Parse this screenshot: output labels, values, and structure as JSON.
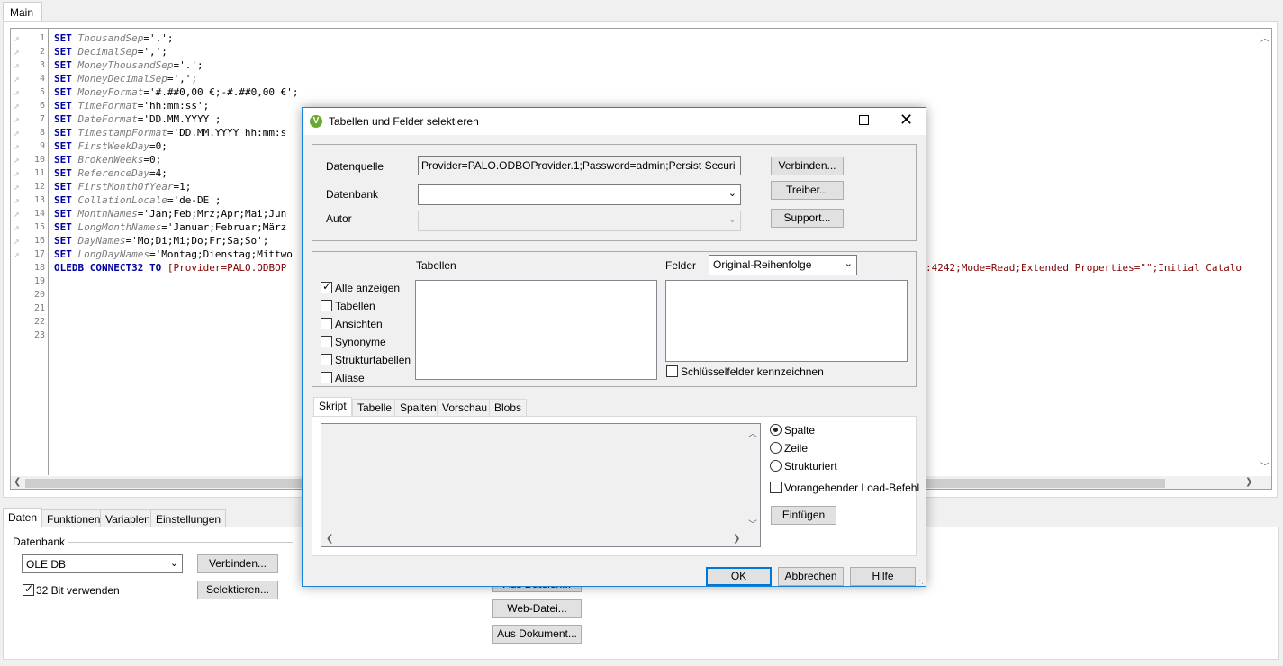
{
  "top_tab": "Main",
  "editor": {
    "lines": [
      {
        "n": "1",
        "kw": "SET",
        "var": "ThousandSep",
        "rest": "='.';"
      },
      {
        "n": "2",
        "kw": "SET",
        "var": "DecimalSep",
        "rest": "=',';"
      },
      {
        "n": "3",
        "kw": "SET",
        "var": "MoneyThousandSep",
        "rest": "='.';"
      },
      {
        "n": "4",
        "kw": "SET",
        "var": "MoneyDecimalSep",
        "rest": "=',';"
      },
      {
        "n": "5",
        "kw": "SET",
        "var": "MoneyFormat",
        "rest": "='#.##0,00 €;-#.##0,00 €';"
      },
      {
        "n": "6",
        "kw": "SET",
        "var": "TimeFormat",
        "rest": "='hh:mm:ss';"
      },
      {
        "n": "7",
        "kw": "SET",
        "var": "DateFormat",
        "rest": "='DD.MM.YYYY';"
      },
      {
        "n": "8",
        "kw": "SET",
        "var": "TimestampFormat",
        "rest": "='DD.MM.YYYY hh:mm:s"
      },
      {
        "n": "9",
        "kw": "SET",
        "var": "FirstWeekDay",
        "rest": "=0;"
      },
      {
        "n": "10",
        "kw": "SET",
        "var": "BrokenWeeks",
        "rest": "=0;"
      },
      {
        "n": "11",
        "kw": "SET",
        "var": "ReferenceDay",
        "rest": "=4;"
      },
      {
        "n": "12",
        "kw": "SET",
        "var": "FirstMonthOfYear",
        "rest": "=1;"
      },
      {
        "n": "13",
        "kw": "SET",
        "var": "CollationLocale",
        "rest": "='de-DE';"
      },
      {
        "n": "14",
        "kw": "SET",
        "var": "MonthNames",
        "rest": "='Jan;Feb;Mrz;Apr;Mai;Jun"
      },
      {
        "n": "15",
        "kw": "SET",
        "var": "LongMonthNames",
        "rest": "='Januar;Februar;März"
      },
      {
        "n": "16",
        "kw": "SET",
        "var": "DayNames",
        "rest": "='Mo;Di;Mi;Do;Fr;Sa;So';"
      },
      {
        "n": "17",
        "kw": "SET",
        "var": "LongDayNames",
        "rest": "='Montag;Dienstag;Mittwo"
      }
    ],
    "line18": {
      "n": "18",
      "kw1": "OLEDB",
      "kw2": "CONNECT32",
      "kw3": "TO",
      "rest": "[Provider=PALO.ODBOP"
    },
    "line18_tail": ":4242;Mode=Read;Extended Properties=\"\";Initial Catalo",
    "empty_lines": [
      "19",
      "20",
      "21",
      "22",
      "23"
    ]
  },
  "bottom": {
    "tabs": [
      "Daten",
      "Funktionen",
      "Variablen",
      "Einstellungen"
    ],
    "group_label": "Datenbank",
    "db_select": "OLE DB",
    "connect_button": "Verbinden...",
    "use32_label": "32 Bit verwenden",
    "select_button": "Selektieren...",
    "web_file_button": "Web-Datei...",
    "from_doc_button": "Aus Dokument...",
    "hidden_button": "Aus Dateien..."
  },
  "dialog": {
    "title": "Tabellen und Felder selektieren",
    "datasource_label": "Datenquelle",
    "datasource_value": "Provider=PALO.ODBOProvider.1;Password=admin;Persist Securi",
    "database_label": "Datenbank",
    "database_value": "",
    "author_label": "Autor",
    "connect_button": "Verbinden...",
    "driver_button": "Treiber...",
    "support_button": "Support...",
    "tables_label": "Tabellen",
    "fields_label": "Felder",
    "fields_order": "Original-Reihenfolge",
    "show_options": [
      {
        "label": "Alle anzeigen",
        "checked": true
      },
      {
        "label": "Tabellen",
        "checked": false
      },
      {
        "label": "Ansichten",
        "checked": false
      },
      {
        "label": "Synonyme",
        "checked": false
      },
      {
        "label": "Strukturtabellen",
        "checked": false
      },
      {
        "label": "Aliase",
        "checked": false
      }
    ],
    "mark_keys_label": "Schlüsselfelder kennzeichnen",
    "tabs": [
      "Skript",
      "Tabelle",
      "Spalten",
      "Vorschau",
      "Blobs"
    ],
    "radios": [
      {
        "label": "Spalte",
        "checked": true
      },
      {
        "label": "Zeile",
        "checked": false
      },
      {
        "label": "Strukturiert",
        "checked": false
      }
    ],
    "preceding_load_label": "Vorangehender Load-Befehl",
    "insert_button": "Einfügen",
    "ok_button": "OK",
    "cancel_button": "Abbrechen",
    "help_button": "Hilfe"
  },
  "colors": {
    "accent": "#0078d7",
    "keyword": "#0000a0",
    "logo": "#6aa832"
  }
}
